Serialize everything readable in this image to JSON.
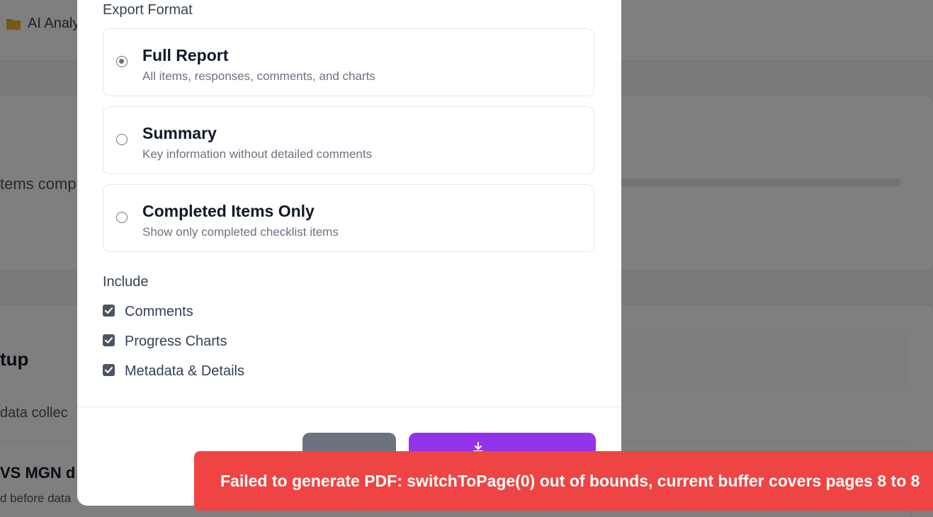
{
  "background": {
    "breadcrumb_folder": "AI Analy",
    "progress_text": "tems comp",
    "section_heading": "tup",
    "section_desc": "data collec",
    "item_title": "VS MGN d",
    "item_desc": "d before data"
  },
  "modal": {
    "export_format_label": "Export Format",
    "options": [
      {
        "title": "Full Report",
        "desc": "All items, responses, comments, and charts",
        "selected": true
      },
      {
        "title": "Summary",
        "desc": "Key information without detailed comments",
        "selected": false
      },
      {
        "title": "Completed Items Only",
        "desc": "Show only completed checklist items",
        "selected": false
      }
    ],
    "include_label": "Include",
    "include_items": [
      {
        "label": "Comments",
        "checked": true
      },
      {
        "label": "Progress Charts",
        "checked": true
      },
      {
        "label": "Metadata & Details",
        "checked": true
      }
    ],
    "cancel_label": "",
    "export_label": ""
  },
  "toast": {
    "message": "Failed to generate PDF: switchToPage(0) out of bounds, current buffer covers pages 8 to 8"
  },
  "colors": {
    "accent": "#9333ea",
    "error": "#ef4444",
    "muted_button": "#6b7280"
  }
}
